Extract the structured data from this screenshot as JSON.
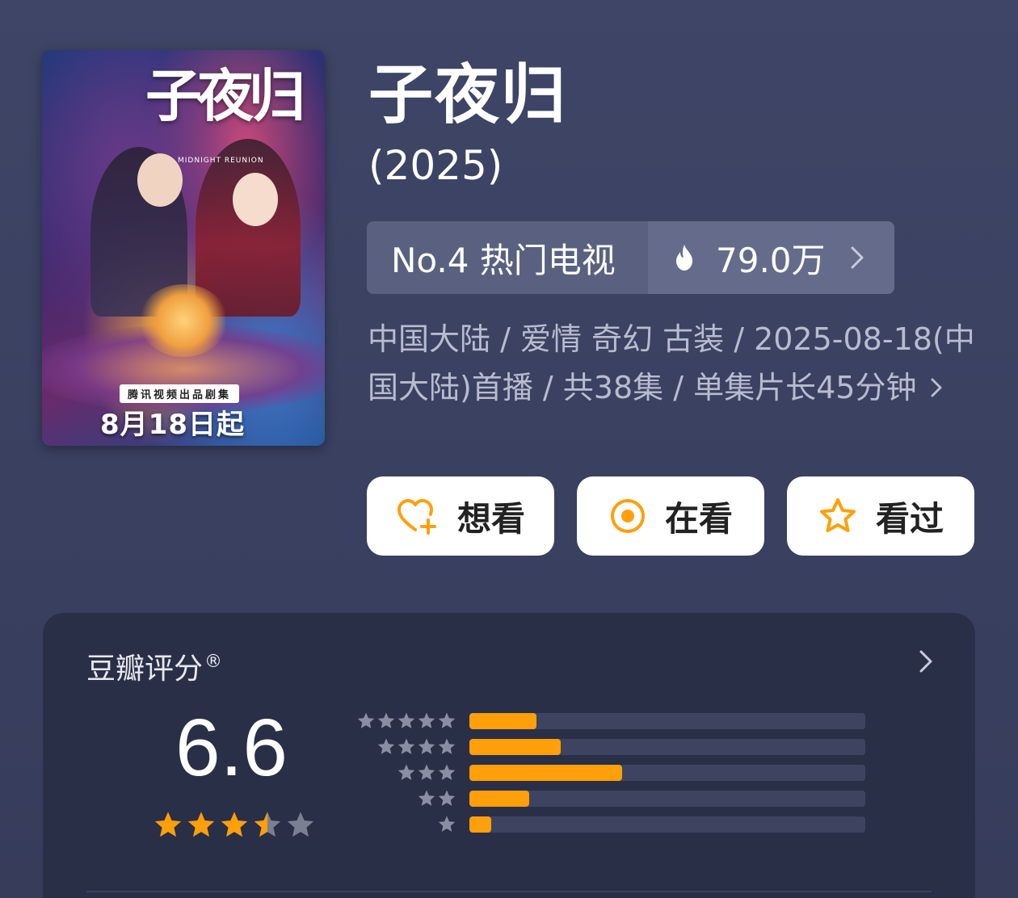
{
  "poster": {
    "title_art": "子夜归",
    "subtitle_art": "MIDNIGHT REUNION",
    "badge": "腾讯视频出品剧集",
    "date": "8月18日起"
  },
  "show": {
    "title": "子夜归",
    "year": "(2025)"
  },
  "rank": {
    "label": "No.4 热门电视",
    "heat": "79.0万",
    "heat_icon": "fire-icon",
    "chevron_icon": "chevron-right-icon"
  },
  "meta": {
    "line": "中国大陆 / 爱情 奇幻 古装 / 2025-08-18(中国大陆)首播 / 共38集 / 单集片长45分钟"
  },
  "actions": {
    "want": {
      "label": "想看",
      "icon": "heart-plus-icon"
    },
    "watching": {
      "label": "在看",
      "icon": "target-circle-icon"
    },
    "watched": {
      "label": "看过",
      "icon": "star-outline-icon"
    }
  },
  "rating": {
    "title": "豆瓣评分",
    "reg_mark": "®",
    "score": "6.6",
    "stars": 3.5,
    "distribution": [
      {
        "stars": 5,
        "fraction": 0.17
      },
      {
        "stars": 4,
        "fraction": 0.23
      },
      {
        "stars": 3,
        "fraction": 0.385
      },
      {
        "stars": 2,
        "fraction": 0.15
      },
      {
        "stars": 1,
        "fraction": 0.055
      }
    ]
  },
  "colors": {
    "accent": "#ff9f0a",
    "card_bg": "#2a2f48",
    "page_bg": "#3c4263"
  }
}
